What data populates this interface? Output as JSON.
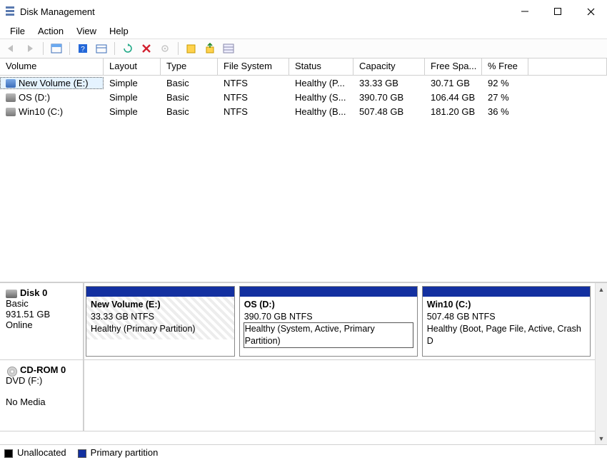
{
  "title": "Disk Management",
  "menubar": {
    "items": [
      "File",
      "Action",
      "View",
      "Help"
    ]
  },
  "toolbar_icons": [
    "back-arrow-icon",
    "forward-arrow-icon",
    "table-icon",
    "help-icon",
    "calendar-icon",
    "refresh-icon",
    "delete-x-icon",
    "gear-icon",
    "new-volume-icon",
    "export-icon",
    "properties-icon"
  ],
  "list": {
    "headers": [
      "Volume",
      "Layout",
      "Type",
      "File System",
      "Status",
      "Capacity",
      "Free Spa...",
      "% Free"
    ],
    "rows": [
      {
        "icon": "blue",
        "volume": "New Volume (E:)",
        "layout": "Simple",
        "type": "Basic",
        "fs": "NTFS",
        "status": "Healthy (P...",
        "capacity": "33.33 GB",
        "free": "30.71 GB",
        "pct": "92 %",
        "selected": true
      },
      {
        "icon": "gray",
        "volume": "OS (D:)",
        "layout": "Simple",
        "type": "Basic",
        "fs": "NTFS",
        "status": "Healthy (S...",
        "capacity": "390.70 GB",
        "free": "106.44 GB",
        "pct": "27 %",
        "selected": false
      },
      {
        "icon": "gray",
        "volume": "Win10 (C:)",
        "layout": "Simple",
        "type": "Basic",
        "fs": "NTFS",
        "status": "Healthy (B...",
        "capacity": "507.48 GB",
        "free": "181.20 GB",
        "pct": "36 %",
        "selected": false
      }
    ]
  },
  "devices": [
    {
      "kind": "disk",
      "name": "Disk 0",
      "lines": [
        "Basic",
        "931.51 GB",
        "Online"
      ],
      "partitions": [
        {
          "title": "New Volume  (E:)",
          "size": "33.33 GB NTFS",
          "status": "Healthy (Primary Partition)",
          "bar": "primary",
          "hatched": true,
          "highlight": false,
          "flex": 0.3
        },
        {
          "title": "OS  (D:)",
          "size": "390.70 GB NTFS",
          "status": "Healthy (System, Active, Primary Partition)",
          "bar": "primary",
          "hatched": false,
          "highlight": true,
          "flex": 0.36
        },
        {
          "title": "Win10  (C:)",
          "size": "507.48 GB NTFS",
          "status": "Healthy (Boot, Page File, Active, Crash D",
          "bar": "primary",
          "hatched": false,
          "highlight": false,
          "flex": 0.34
        }
      ]
    },
    {
      "kind": "cd",
      "name": "CD-ROM 0",
      "lines": [
        "DVD (F:)",
        "",
        "No Media"
      ],
      "partitions": []
    }
  ],
  "legend": {
    "items": [
      {
        "swatch": "black",
        "label": "Unallocated"
      },
      {
        "swatch": "blue",
        "label": "Primary partition"
      }
    ]
  }
}
